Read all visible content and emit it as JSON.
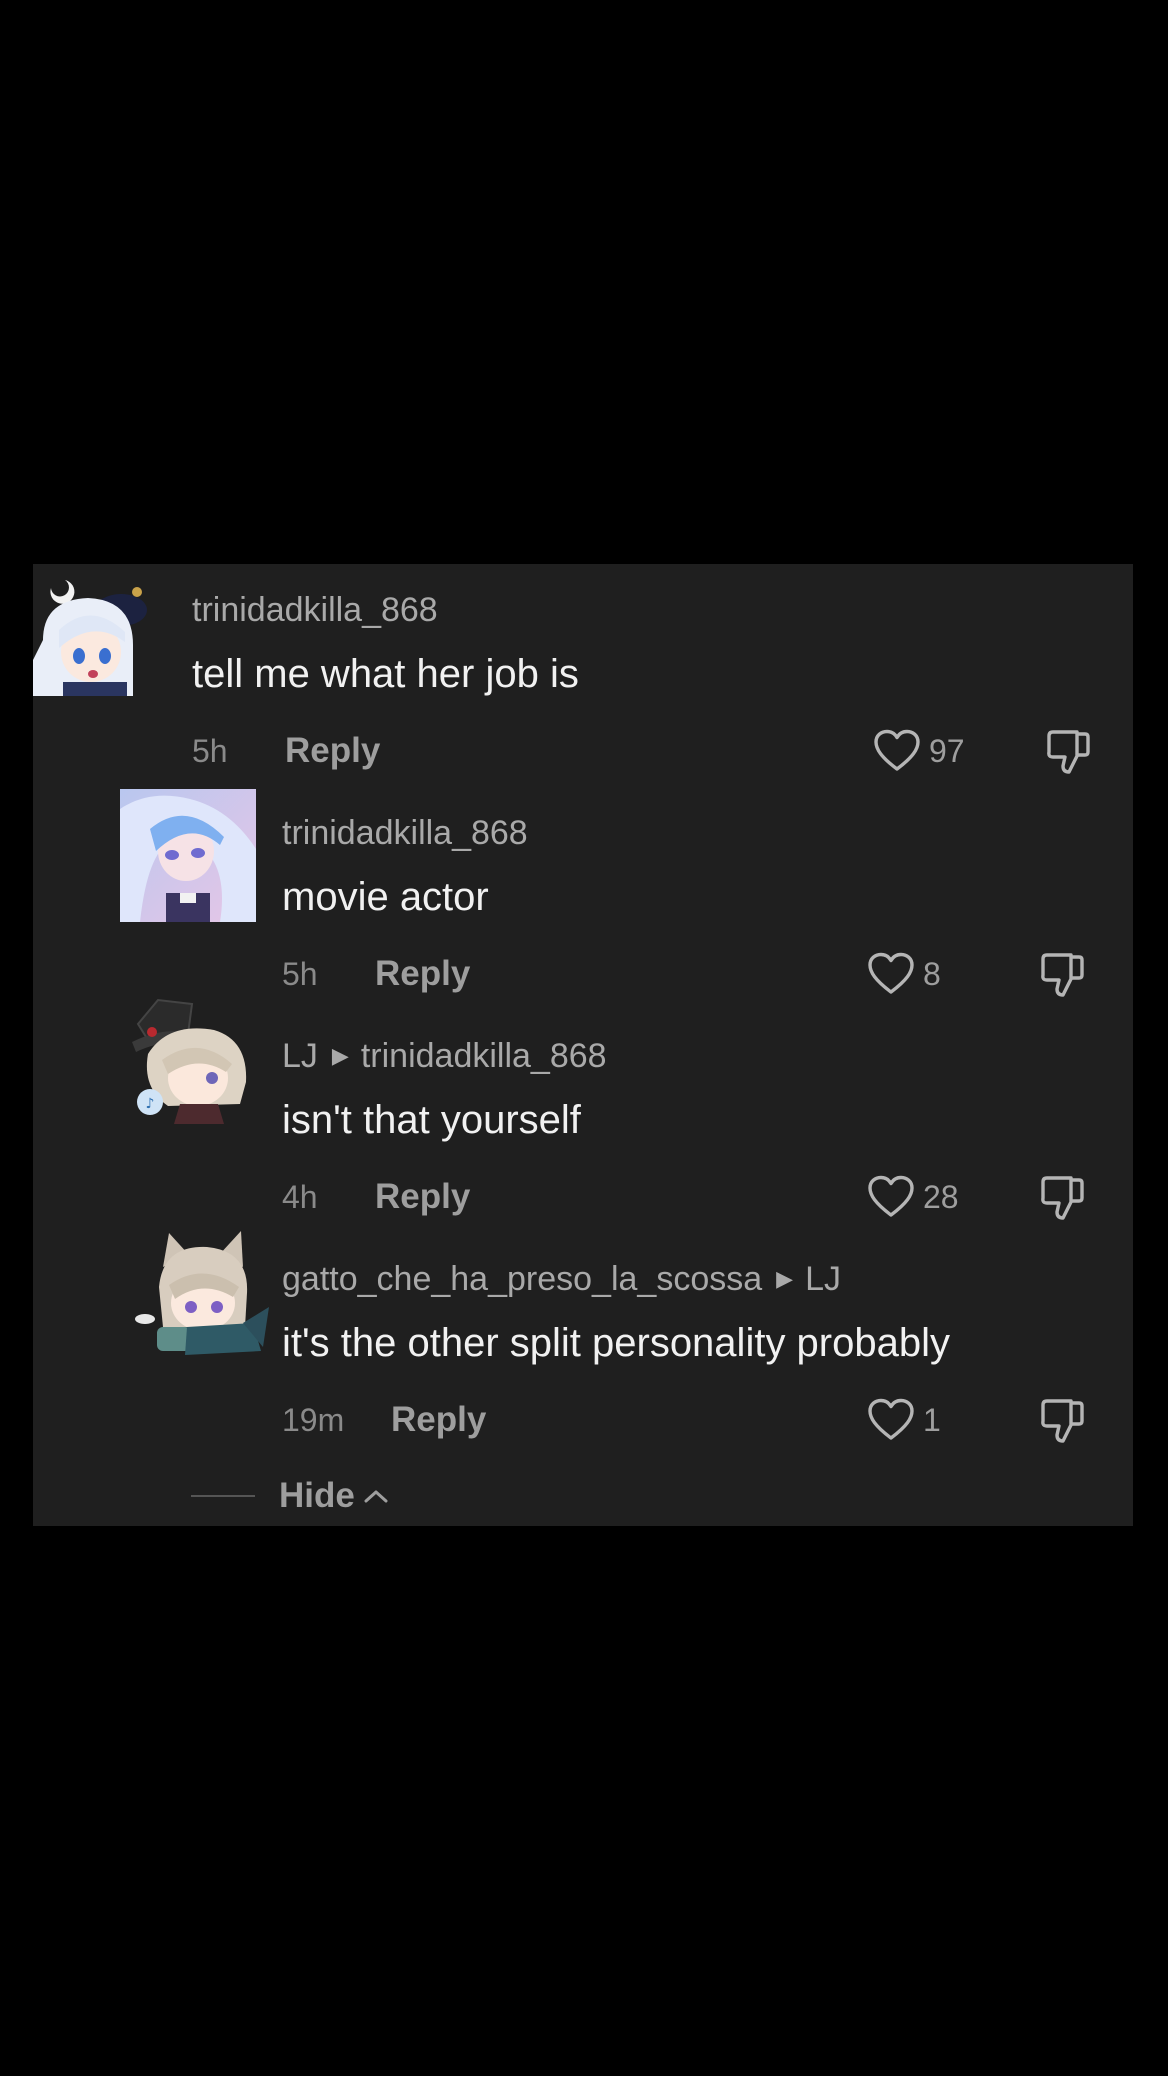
{
  "comments": [
    {
      "username": "trinidadkilla_868",
      "reply_to": "",
      "text": "tell me what her job is",
      "time": "5h",
      "reply_label": "Reply",
      "likes": "97"
    },
    {
      "username": "trinidadkilla_868",
      "reply_to": "",
      "text": "movie actor",
      "time": "5h",
      "reply_label": "Reply",
      "likes": "8"
    },
    {
      "username": "LJ",
      "reply_to": "trinidadkilla_868",
      "text": "isn't that yourself",
      "time": "4h",
      "reply_label": "Reply",
      "likes": "28"
    },
    {
      "username": "gatto_che_ha_preso_la_scossa",
      "reply_to": "LJ",
      "text": "it's the other split personality probably",
      "time": "19m",
      "reply_label": "Reply",
      "likes": "1"
    }
  ],
  "hide_label": "Hide",
  "colors": {
    "page_background": "#000000",
    "panel_background": "#1f1f1f",
    "username": "#a9a9a9",
    "comment_text": "#f1f1f1",
    "meta_text": "#8a8a8a"
  },
  "icons": [
    "heart-outline-icon",
    "dislike-icon",
    "chevron-up-icon",
    "reply-arrow-icon"
  ]
}
